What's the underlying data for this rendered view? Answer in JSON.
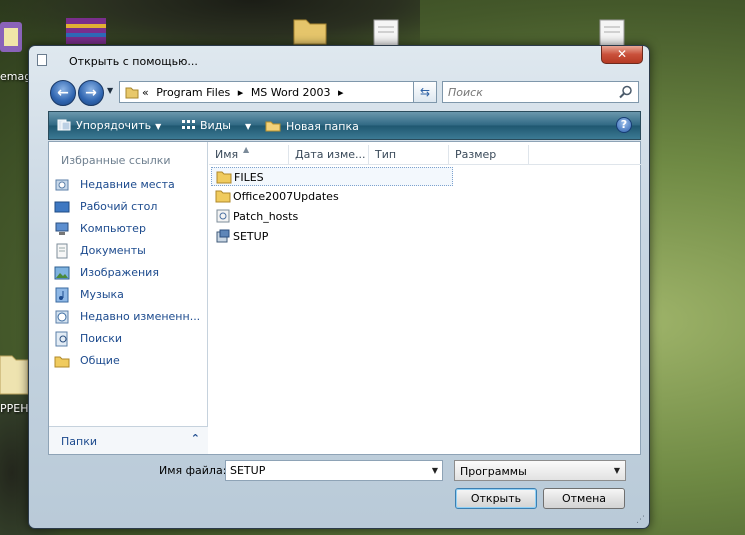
{
  "desktop": {
    "icon_labels": [
      "emag",
      "РРЕН"
    ]
  },
  "window": {
    "title": "Открыть с помощью...",
    "close_glyph": "✕"
  },
  "address": {
    "crumb_prefix": "«",
    "crumbs": [
      "Program Files",
      "MS Word 2003"
    ],
    "separator": "▸"
  },
  "search": {
    "placeholder": "Поиск"
  },
  "toolbar": {
    "organize_label": "Упорядочить",
    "views_label": "Виды",
    "new_folder_label": "Новая папка",
    "help_glyph": "?"
  },
  "nav_pane": {
    "favorites_title": "Избранные ссылки",
    "items": [
      {
        "label": "Недавние места",
        "icon": "recent-places-icon"
      },
      {
        "label": "Рабочий стол",
        "icon": "desktop-icon"
      },
      {
        "label": "Компьютер",
        "icon": "computer-icon"
      },
      {
        "label": "Документы",
        "icon": "documents-icon"
      },
      {
        "label": "Изображения",
        "icon": "pictures-icon"
      },
      {
        "label": "Музыка",
        "icon": "music-icon"
      },
      {
        "label": "Недавно измененн...",
        "icon": "recently-changed-icon"
      },
      {
        "label": "Поиски",
        "icon": "searches-icon"
      },
      {
        "label": "Общие",
        "icon": "public-icon"
      }
    ],
    "folders_label": "Папки",
    "folders_chevron": "⌃"
  },
  "file_list": {
    "columns": [
      "Имя",
      "Дата изме...",
      "Тип",
      "Размер"
    ],
    "sort_indicator": "▲",
    "files": [
      {
        "name": "FILES",
        "icon": "folder-icon",
        "selected": true
      },
      {
        "name": "Office2007Updates",
        "icon": "folder-icon",
        "selected": false
      },
      {
        "name": "Patch_hosts",
        "icon": "shortcut-file-icon",
        "selected": false
      },
      {
        "name": "SETUP",
        "icon": "setup-exe-icon",
        "selected": false
      }
    ]
  },
  "footer": {
    "filename_label": "Имя файла:",
    "filename_value": "SETUP",
    "filetype_value": "Программы",
    "open_label": "Открыть",
    "cancel_label": "Отмена"
  },
  "colors": {
    "toolbar": "#2f6883",
    "link_text": "#1d4b8e",
    "selection_border": "#7da2ce"
  }
}
